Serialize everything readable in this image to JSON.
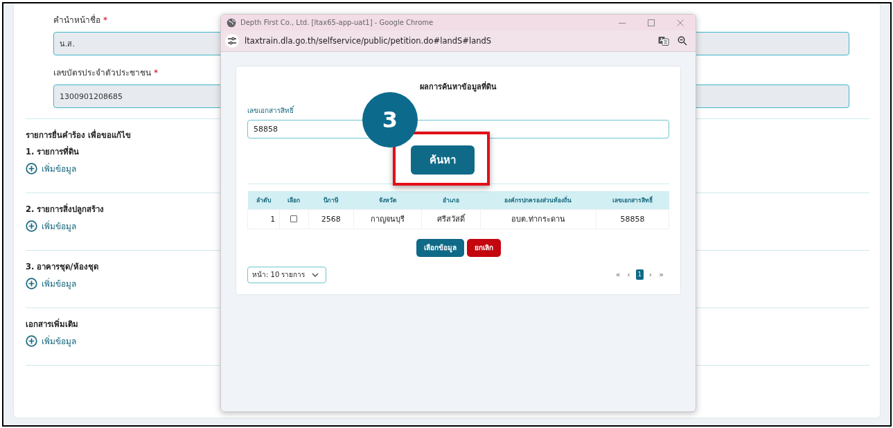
{
  "form": {
    "fields": [
      {
        "label": "คำนำหน้าชื่อ",
        "required_mark": "*",
        "value": "น.ส."
      },
      {
        "label": "เลขบัตรประจำตัวประชาชน",
        "required_mark": "*",
        "value": "1300901208685"
      }
    ],
    "sections": [
      {
        "headings": [
          "รายการยื่นคำร้อง เพื่อขอแก้ไข",
          "1. รายการที่ดิน"
        ],
        "add_label": "เพิ่มข้อมูล"
      },
      {
        "headings": [
          "2. รายการสิ่งปลูกสร้าง"
        ],
        "add_label": "เพิ่มข้อมูล"
      },
      {
        "headings": [
          "3. อาคารชุด/ห้องชุด"
        ],
        "add_label": "เพิ่มข้อมูล"
      },
      {
        "headings": [
          "เอกสารเพิ่มเติม"
        ],
        "add_label": "เพิ่มข้อมูล"
      }
    ]
  },
  "popup": {
    "window_title": "Depth First Co., Ltd. [ltax65-app-uat1] - Google Chrome",
    "url": "ltaxtrain.dla.go.th/selfservice/public/petition.do#landS#landS",
    "title": "ผลการค้นหาข้อมูลที่ดิน",
    "search_label": "เลขเอกสารสิทธิ์",
    "search_value": "58858",
    "search_button": "ค้นหา",
    "step_badge": "3",
    "table": {
      "columns": [
        "ลำดับ",
        "เลือก",
        "ปีภาษี",
        "จังหวัด",
        "อำเภอ",
        "องค์กรปกครองส่วนท้องถิ่น",
        "เลขเอกสารสิทธิ์"
      ],
      "rows": [
        {
          "checked": false,
          "cells": [
            "1",
            "",
            "2568",
            "กาญจนบุรี",
            "ศรีสวัสดิ์",
            "อบต.ท่ากระดาน",
            "58858"
          ]
        }
      ]
    },
    "buttons": [
      {
        "label": "เลือกข้อมูล",
        "kind": "primary"
      },
      {
        "label": "ยกเลิก",
        "kind": "danger"
      }
    ],
    "page_size": "หน้า: 10 รายการ",
    "pagination": [
      {
        "label": "«",
        "selected": false
      },
      {
        "label": "‹",
        "selected": false
      },
      {
        "label": "1",
        "selected": true
      },
      {
        "label": "›",
        "selected": false
      },
      {
        "label": "»",
        "selected": false
      }
    ]
  }
}
